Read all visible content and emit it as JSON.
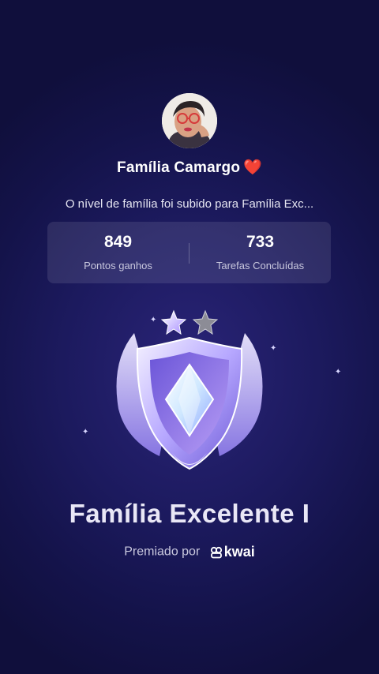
{
  "profile": {
    "family_name": "Família Camargo",
    "heart_emoji": "❤️"
  },
  "message": "O nível de família foi subido para Família Exc...",
  "stats": [
    {
      "value": "849",
      "label": "Pontos ganhos"
    },
    {
      "value": "733",
      "label": "Tarefas Concluídas"
    }
  ],
  "badge": {
    "title": "Família Excelente I",
    "stars_filled": 1,
    "stars_total": 2,
    "icon": "shield-crystal-icon"
  },
  "award": {
    "prefix": "Premiado por",
    "brand": "kwai"
  },
  "colors": {
    "background": "#1c1a5e",
    "heart": "#e02b3c",
    "badge_purple": "#8a78f0"
  }
}
